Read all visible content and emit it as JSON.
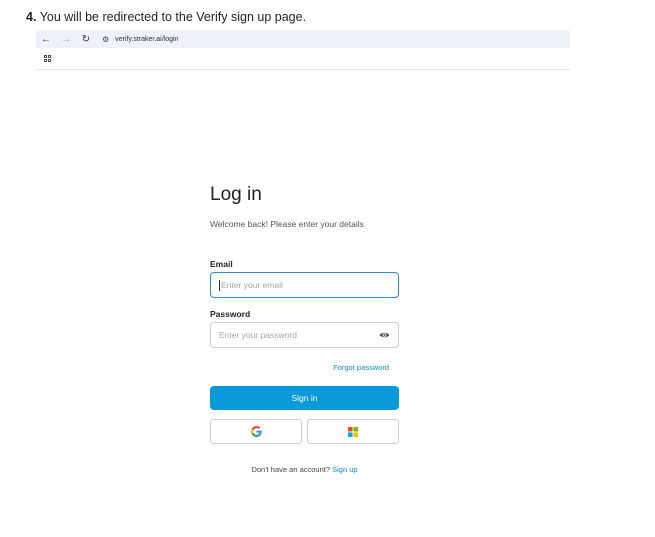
{
  "instruction": {
    "step_number": "4.",
    "text": "You will be redirected to the Verify sign up page."
  },
  "browser": {
    "back_icon": "arrow-left",
    "forward_icon": "arrow-right",
    "reload_icon": "reload",
    "site_settings_icon": "tune",
    "url": "verify.straker.ai/login",
    "apps_icon": "apps-grid"
  },
  "login": {
    "title": "Log in",
    "subtitle": "Welcome back! Please enter your details",
    "email_label": "Email",
    "email_placeholder": "Enter your email",
    "password_label": "Password",
    "password_placeholder": "Enter your password",
    "forgot_password": "Forgot password",
    "sign_in": "Sign in",
    "no_account_text": "Don't have an account?",
    "sign_up_link": "Sign up"
  },
  "colors": {
    "primary": "#0a9ad9",
    "link": "#1488c8",
    "focus_border": "#2b8fc7"
  }
}
